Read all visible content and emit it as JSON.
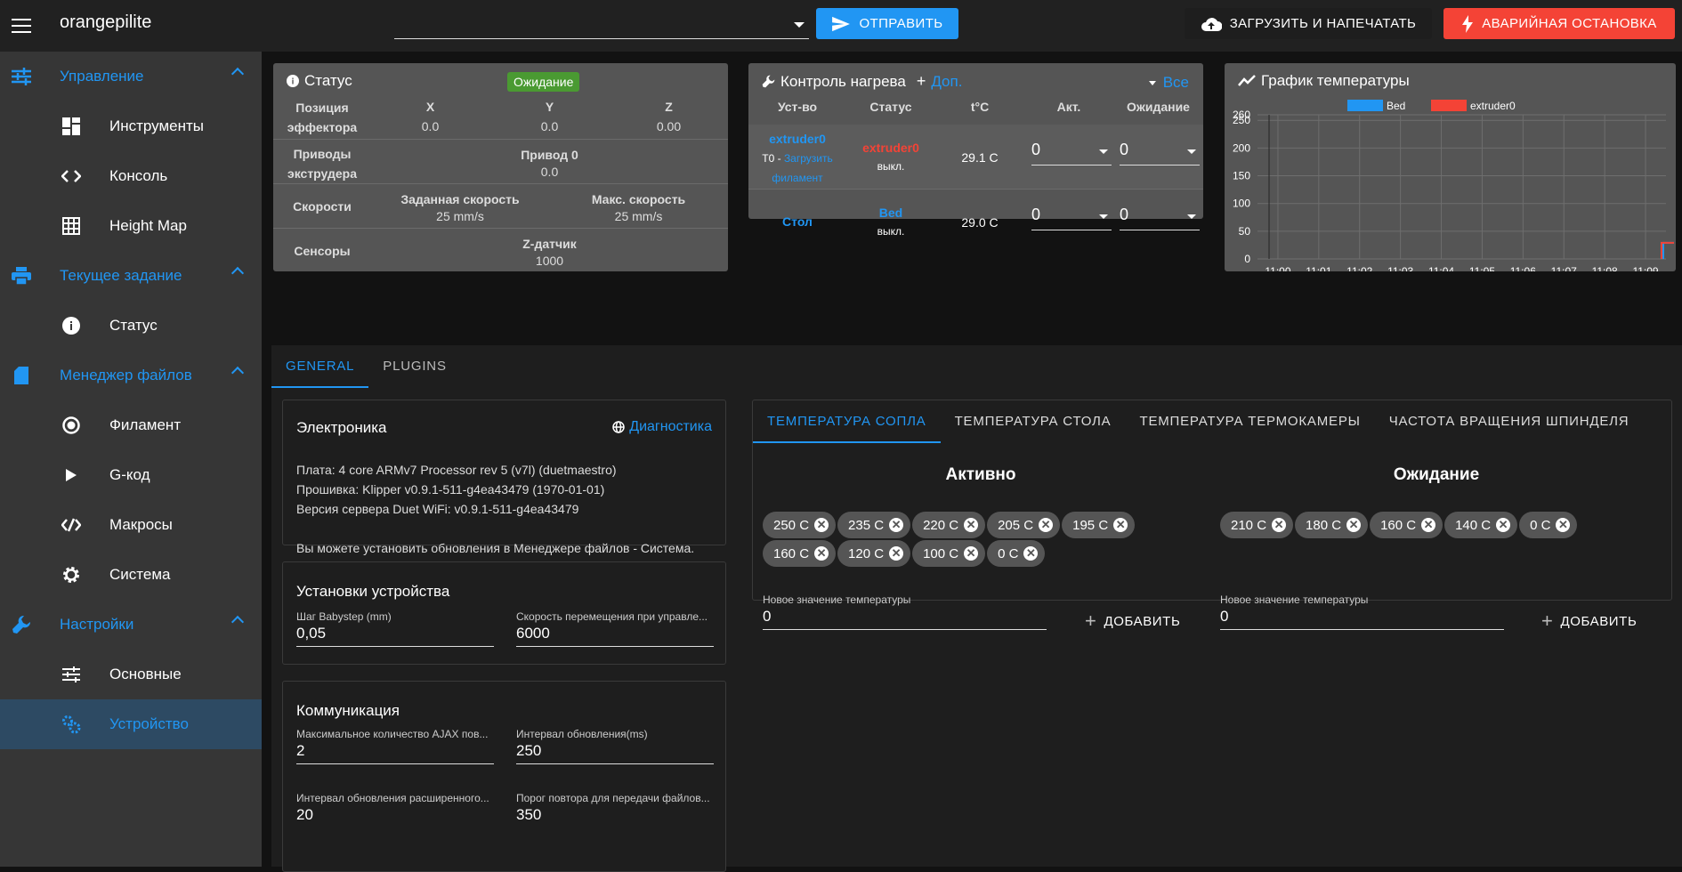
{
  "app": {
    "title": "orangepilite"
  },
  "toolbar": {
    "send_label": "ОТПРАВИТЬ",
    "upload_label": "ЗАГРУЗИТЬ И НАПЕЧАТАТЬ",
    "estop_label": "АВАРИЙНАЯ ОСТАНОВКА",
    "gcode_value": ""
  },
  "sidebar": {
    "groups": [
      {
        "label": "Управление",
        "icon": "sliders-icon"
      },
      {
        "label": "Текущее задание",
        "icon": "printer-icon"
      },
      {
        "label": "Менеджер файлов",
        "icon": "sd-card-icon"
      },
      {
        "label": "Настройки",
        "icon": "wrench-icon"
      }
    ],
    "items": [
      {
        "label": "Инструменты",
        "icon": "dashboard-icon"
      },
      {
        "label": "Консоль",
        "icon": "code-icon"
      },
      {
        "label": "Height Map",
        "icon": "grid-icon"
      },
      {
        "label": "Статус",
        "icon": "info-icon"
      },
      {
        "label": "Филамент",
        "icon": "radio-target-icon"
      },
      {
        "label": "G-код",
        "icon": "play-icon"
      },
      {
        "label": "Макросы",
        "icon": "macro-code-icon"
      },
      {
        "label": "Система",
        "icon": "gear-icon"
      },
      {
        "label": "Основные",
        "icon": "tune-icon"
      },
      {
        "label": "Устройство",
        "icon": "cogs-icon"
      }
    ]
  },
  "status": {
    "title": "Статус",
    "badge": "Ожидание",
    "pos_label_1": "Позиция",
    "pos_label_2": "эффектора",
    "x_label": "X",
    "y_label": "Y",
    "z_label": "Z",
    "x": "0.0",
    "y": "0.0",
    "z": "0.00",
    "drives_label_1": "Приводы",
    "drives_label_2": "экструдера",
    "drive0_label": "Привод 0",
    "drive0": "0.0",
    "speeds_label": "Скорости",
    "req_speed_label": "Заданная скорость",
    "req_speed": "25 mm/s",
    "max_speed_label": "Макс. скорость",
    "max_speed": "25 mm/s",
    "sensors_label": "Сенсоры",
    "zprobe_label": "Z-датчик",
    "zprobe": "1000"
  },
  "heat": {
    "title": "Контроль нагрева",
    "extra_label": "Доп.",
    "all_label": "Все",
    "headers": [
      "Уст-во",
      "Статус",
      "t°C",
      "Акт.",
      "Ожидание"
    ],
    "rows": [
      {
        "device": "extruder0",
        "sub1": "T0 - ",
        "sub_link": "Загрузить",
        "sub2": "филамент",
        "status_name": "extruder0",
        "status_state": "выкл.",
        "temp": "29.1 C",
        "active": "0",
        "standby": "0"
      },
      {
        "device": "Стол",
        "status_name": "Bed",
        "status_state": "выкл.",
        "temp": "29.0 C",
        "active": "0",
        "standby": "0"
      }
    ]
  },
  "chart_data": {
    "type": "line",
    "title": "График температуры",
    "series": [
      {
        "name": "Bed",
        "color": "#2196f3",
        "values": [
          29
        ]
      },
      {
        "name": "extruder0",
        "color": "#f44336",
        "values": [
          29
        ]
      }
    ],
    "x_ticks": [
      "11:00",
      "11:01",
      "11:02",
      "11:03",
      "11:04",
      "11:05",
      "11:06",
      "11:07",
      "11:08",
      "11:09"
    ],
    "y_ticks": [
      "0",
      "50",
      "100",
      "150",
      "200",
      "250",
      "260"
    ],
    "ylim": [
      0,
      260
    ]
  },
  "settings": {
    "tabs": [
      "GENERAL",
      "PLUGINS"
    ],
    "electronics": {
      "title": "Электроника",
      "diag_label": "Диагностика",
      "board": "Плата: 4 core ARMv7 Processor rev 5 (v7l) (duetmaestro)",
      "firmware": "Прошивка: Klipper v0.9.1-511-g4ea43479 (1970-01-01)",
      "server": "Версия сервера Duet WiFi: v0.9.1-511-g4ea43479",
      "note": "Вы можете установить обновления в Менеджере файлов - Система."
    },
    "machine": {
      "title": "Установки устройства",
      "babystep_label": "Шаг Babystep (mm)",
      "babystep": "0,05",
      "move_speed_label": "Скорость перемещения при управле...",
      "move_speed": "6000"
    },
    "comm": {
      "title": "Коммуникация",
      "ajax_label": "Максимальное количество AJAX пов...",
      "ajax": "2",
      "update_label": "Интервал обновления(ms)",
      "update": "250",
      "ext_label": "Интервал обновления расширенного...",
      "ext": "20",
      "retry_label": "Порог повтора для передачи файлов...",
      "retry": "350"
    },
    "temps": {
      "tabs": [
        "ТЕМПЕРАТУРА СОПЛА",
        "ТЕМПЕРАТУРА СТОЛА",
        "ТЕМПЕРАТУРА ТЕРМОКАМЕРЫ",
        "ЧАСТОТА ВРАЩЕНИЯ ШПИНДЕЛЯ"
      ],
      "active_title": "Активно",
      "standby_title": "Ожидание",
      "active_chips": [
        "250 C",
        "235 C",
        "220 C",
        "205 C",
        "195 C",
        "160 C",
        "120 C",
        "100 C",
        "0 C"
      ],
      "standby_chips": [
        "210 C",
        "180 C",
        "160 C",
        "140 C",
        "0 C"
      ],
      "new_label": "Новое значение температуры",
      "new_active": "0",
      "new_standby": "0",
      "add_label": "ДОБАВИТЬ"
    }
  }
}
